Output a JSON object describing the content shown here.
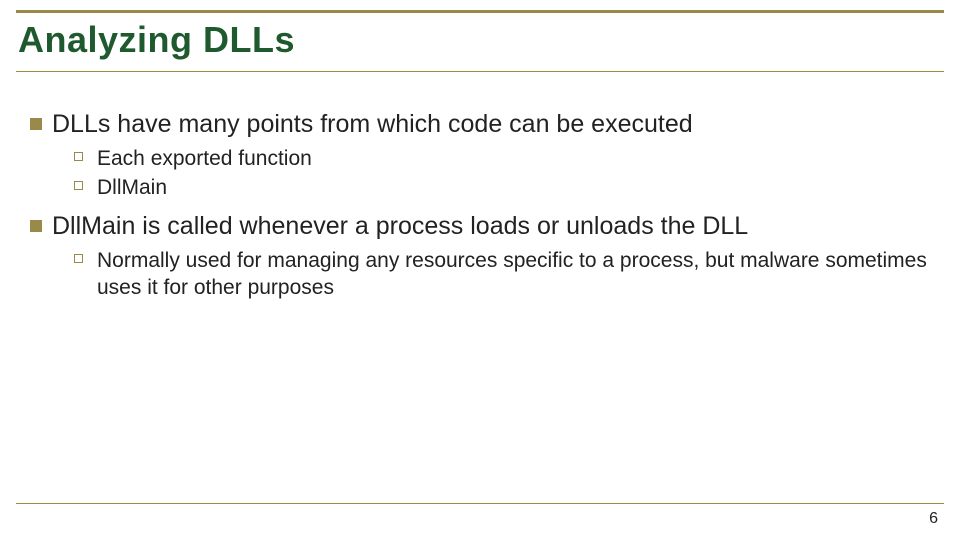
{
  "title": "Analyzing DLLs",
  "bullets": [
    {
      "text": "DLLs have many points from which code can be executed",
      "sub": [
        "Each exported function",
        "DllMain"
      ]
    },
    {
      "text": "DllMain is called whenever a process loads or unloads the DLL",
      "sub": [
        "Normally used for managing any resources specific to a process, but malware sometimes uses it for other purposes"
      ]
    }
  ],
  "page_number": "6"
}
